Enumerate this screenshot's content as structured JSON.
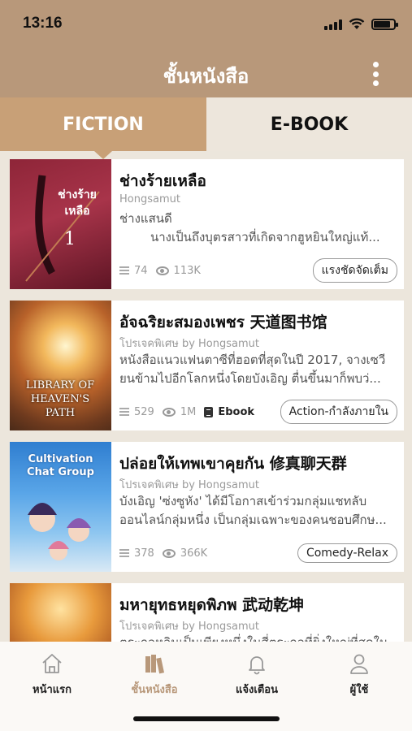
{
  "status_bar": {
    "time": "13:16"
  },
  "header": {
    "title": "ชั้นหนังสือ"
  },
  "tabs": [
    {
      "label": "FICTION",
      "active": true
    },
    {
      "label": "E-BOOK",
      "active": false
    }
  ],
  "books": [
    {
      "title": "ช่างร้ายเหลือ",
      "author": "Hongsamut",
      "description_line1": "ช่างแสนดี",
      "description_line2": "นางเป็นถึงบุตรสาวที่เกิดจากฮูหยินใหญ่แท้...",
      "chapters": "74",
      "views": "113K",
      "ebook_label": "",
      "tag": "แรงชัดจัดเต็ม",
      "cover_text": "ช่างร้ายเหลือ",
      "cover_number": "1"
    },
    {
      "title": "อัจฉริยะสมองเพชร 天道图书馆",
      "author": "โปรเจคพิเศษ by Hongsamut",
      "description_line1": "หนังสือแนวแฟนตาซีที่ฮอตที่สุดในปี 2017, จางเซวี",
      "description_line2": "ยนข้ามไปอีกโลกหนึ่งโดยบังเอิญ ตื่นขึ้นมาก็พบว่...",
      "chapters": "529",
      "views": "1M",
      "ebook_label": "Ebook",
      "tag": "Action-กำลังภายใน",
      "cover_text": "LIBRARY OF HEAVEN'S PATH"
    },
    {
      "title": "ปล่อยให้เทพเขาคุยกัน 修真聊天群",
      "author": "โปรเจคพิเศษ by Hongsamut",
      "description_line1": "บังเอิญ 'ซ่งซูหัง' ได้มีโอกาสเข้าร่วมกลุ่มแชทลับ",
      "description_line2": "ออนไลน์กลุ่มหนึ่ง เป็นกลุ่มเฉพาะของคนชอบศึกษ...",
      "chapters": "378",
      "views": "366K",
      "ebook_label": "",
      "tag": "Comedy-Relax",
      "cover_text": "Cultivation Chat Group"
    },
    {
      "title": "มหายุทธหยุดพิภพ 武动乾坤",
      "author": "โปรเจคพิเศษ by Hongsamut",
      "description_line1": "ตระกูลหลินเป็นเพียงหนึ่งในสี่ตระกูลที่ยิ่งใหญ่ที่สุดใน",
      "description_line2": "",
      "chapters": "",
      "views": "",
      "ebook_label": "",
      "tag": ""
    }
  ],
  "bottom_nav": [
    {
      "label": "หน้าแรก",
      "icon": "home-icon",
      "active": false
    },
    {
      "label": "ชั้นหนังสือ",
      "icon": "bookshelf-icon",
      "active": true
    },
    {
      "label": "แจ้งเตือน",
      "icon": "bell-icon",
      "active": false
    },
    {
      "label": "ผู้ใช้",
      "icon": "user-icon",
      "active": false
    }
  ],
  "colors": {
    "header": "#b8987a",
    "tab_active": "#c8a077",
    "accent": "#b8987a"
  }
}
